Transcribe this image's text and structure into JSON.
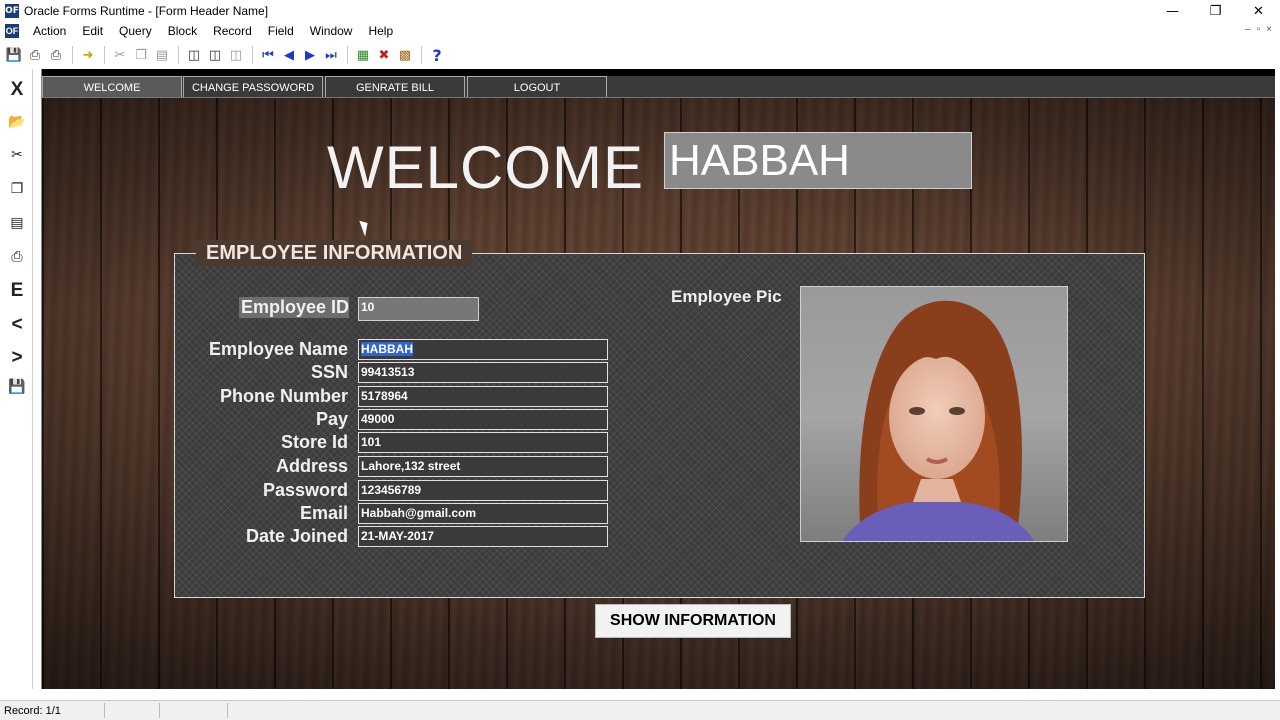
{
  "window": {
    "title": "Oracle Forms Runtime - [Form Header Name]",
    "app_icon_text": "OF",
    "minimize": "—",
    "maximize": "❐",
    "close": "✕"
  },
  "menu": {
    "items": [
      "Action",
      "Edit",
      "Query",
      "Block",
      "Record",
      "Field",
      "Window",
      "Help"
    ],
    "mdi_minimize": "–",
    "mdi_restore": "▫",
    "mdi_close": "×"
  },
  "toolbar": {
    "icons": [
      "save-icon",
      "print-icon",
      "print-setup-icon",
      "exit-icon",
      "cut-icon",
      "copy-icon",
      "paste-icon",
      "enter-query-icon",
      "execute-query-icon",
      "cancel-query-icon",
      "first-record-icon",
      "previous-record-icon",
      "next-record-icon",
      "last-record-icon",
      "insert-record-icon",
      "delete-record-icon",
      "lock-record-icon",
      "help-icon"
    ],
    "help_label": "?"
  },
  "vtoolbar": {
    "exit_label": "X",
    "edit_label": "E",
    "prev_label": "<",
    "next_label": ">"
  },
  "tabs": [
    {
      "label": "WELCOME",
      "active": true
    },
    {
      "label": "CHANGE PASSOWORD",
      "active": false
    },
    {
      "label": "GENRATE BILL",
      "active": false
    },
    {
      "label": "LOGOUT",
      "active": false
    }
  ],
  "welcome": {
    "title": "WELCOME",
    "name": "HABBAH"
  },
  "employee_info": {
    "frame_title": "EMPLOYEE INFORMATION",
    "id_label": "Employee ID",
    "id_value": "10",
    "pic_label": "Employee Pic",
    "fields": [
      {
        "label": "Employee Name",
        "value": "HABBAH"
      },
      {
        "label": "SSN",
        "value": "99413513"
      },
      {
        "label": "Phone Number",
        "value": "5178964"
      },
      {
        "label": "Pay",
        "value": "49000"
      },
      {
        "label": "Store Id",
        "value": "101"
      },
      {
        "label": "Address",
        "value": "Lahore,132 street"
      },
      {
        "label": "Password",
        "value": "123456789"
      },
      {
        "label": "Email",
        "value": "Habbah@gmail.com"
      },
      {
        "label": "Date Joined",
        "value": "21-MAY-2017"
      }
    ]
  },
  "show_button": "SHOW INFORMATION",
  "status": {
    "record": "Record: 1/1"
  }
}
